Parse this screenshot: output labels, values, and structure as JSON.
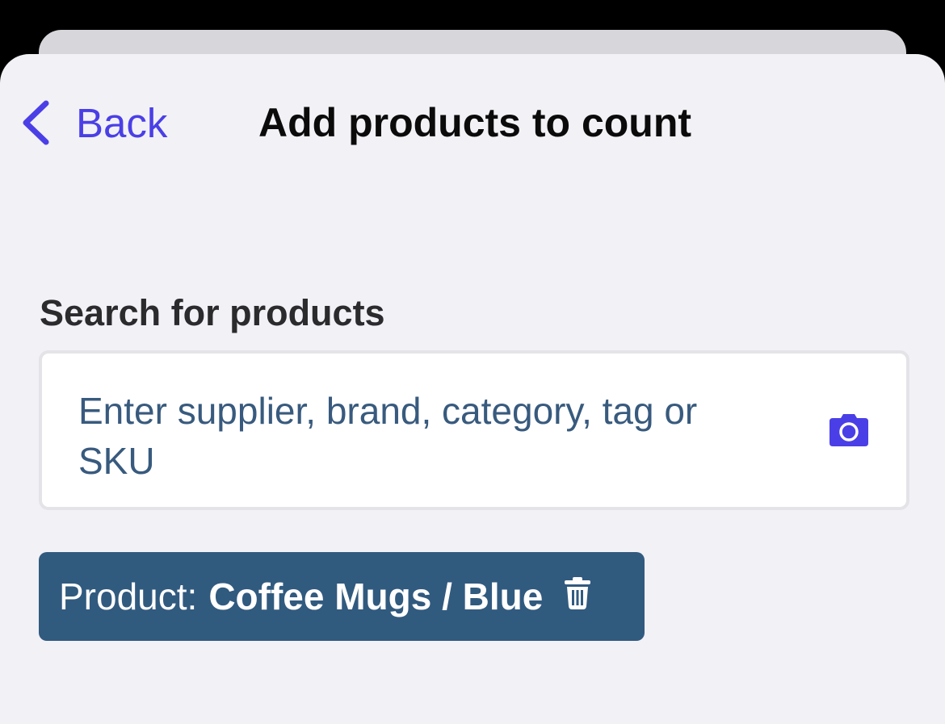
{
  "nav": {
    "back_label": "Back",
    "title": "Add products to count"
  },
  "search": {
    "label": "Search for products",
    "placeholder": "Enter supplier, brand, category, tag or SKU"
  },
  "filter_chip": {
    "prefix": "Product:",
    "value": "Coffee Mugs / Blue"
  },
  "icons": {
    "back": "chevron-left-icon",
    "camera": "camera-icon",
    "delete": "trash-icon"
  },
  "colors": {
    "accent": "#4a3fe6",
    "chip_background": "#315a7f",
    "placeholder_text": "#385a7e",
    "sheet_background": "#f2f1f6"
  }
}
